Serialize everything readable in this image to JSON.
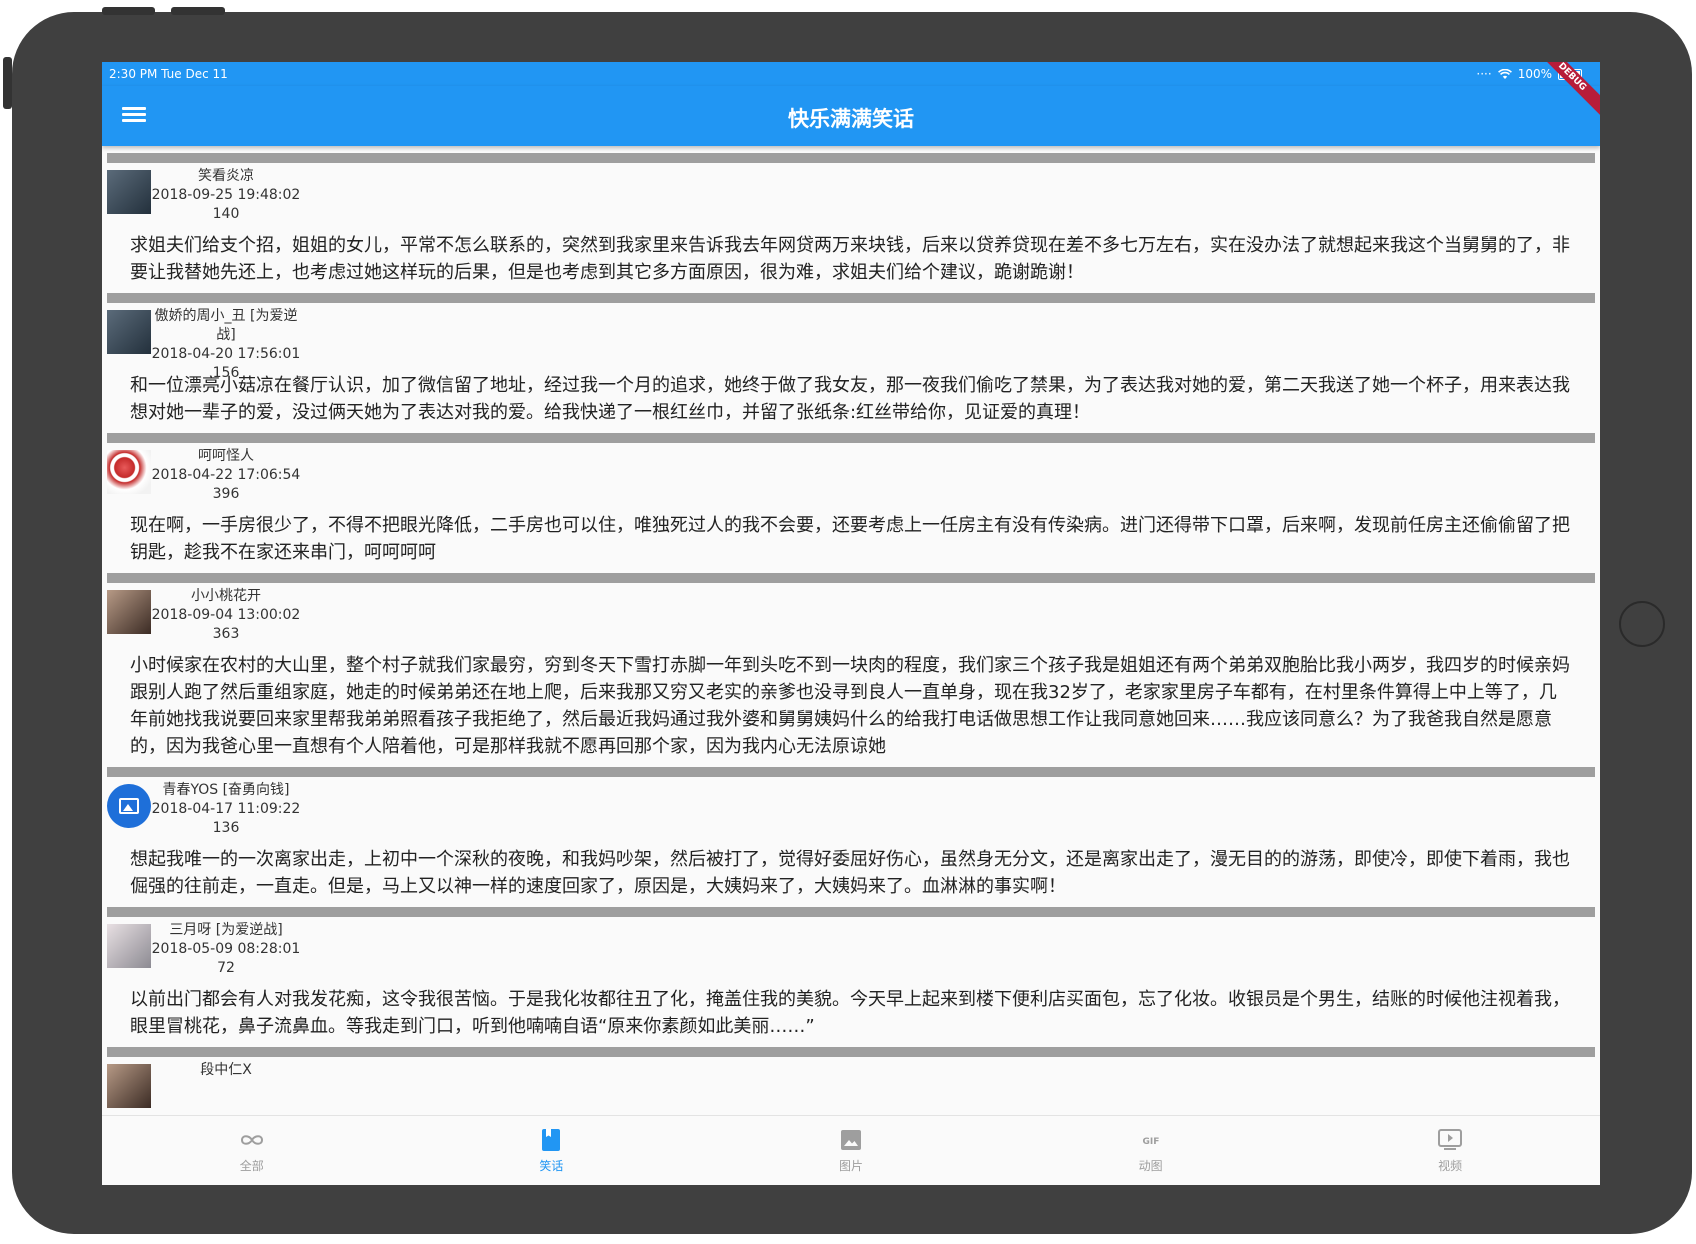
{
  "status_bar": {
    "time": "2:30 PM   Tue Dec 11",
    "battery": "100%",
    "debug": "DEBUG"
  },
  "app_bar": {
    "title": "快乐满满笑话"
  },
  "posts": [
    {
      "author": "笑看炎凉",
      "date": "2018-09-25 19:48:02",
      "count": "140",
      "text": "求姐夫们给支个招，姐姐的女儿，平常不怎么联系的，突然到我家里来告诉我去年网贷两万来块钱，后来以贷养贷现在差不多七万左右，实在没办法了就想起来我这个当舅舅的了，非要让我替她先还上，也考虑过她这样玩的后果，但是也考虑到其它多方面原因，很为难，求姐夫们给个建议，跪谢跪谢！"
    },
    {
      "author": "傲娇的周小_丑 [为爱逆战]",
      "date": "2018-04-20 17:56:01",
      "count": "156",
      "text": "和一位漂亮小菇凉在餐厅认识，加了微信留了地址，经过我一个月的追求，她终于做了我女友，那一夜我们偷吃了禁果，为了表达我对她的爱，第二天我送了她一个杯子，用来表达我想对她一辈子的爱，没过俩天她为了表达对我的爱。给我快递了一根红丝巾，并留了张纸条:红丝带给你，见证爱的真理！"
    },
    {
      "author": "呵呵怪人",
      "date": "2018-04-22 17:06:54",
      "count": "396",
      "text": "现在啊，一手房很少了，不得不把眼光降低，二手房也可以住，唯独死过人的我不会要，还要考虑上一任房主有没有传染病。进门还得带下口罩，后来啊，发现前任房主还偷偷留了把钥匙，趁我不在家还来串门，呵呵呵呵"
    },
    {
      "author": "小小桃花开",
      "date": "2018-09-04 13:00:02",
      "count": "363",
      "text": "小时候家在农村的大山里，整个村子就我们家最穷，穷到冬天下雪打赤脚一年到头吃不到一块肉的程度，我们家三个孩子我是姐姐还有两个弟弟双胞胎比我小两岁，我四岁的时候亲妈跟别人跑了然后重组家庭，她走的时候弟弟还在地上爬，后来我那又穷又老实的亲爹也没寻到良人一直单身，现在我32岁了，老家家里房子车都有，在村里条件算得上中上等了，几年前她找我说要回来家里帮我弟弟照看孩子我拒绝了，然后最近我妈通过我外婆和舅舅姨妈什么的给我打电话做思想工作让我同意她回来……我应该同意么？为了我爸我自然是愿意的，因为我爸心里一直想有个人陪着他，可是那样我就不愿再回那个家，因为我内心无法原谅她"
    },
    {
      "author": "青春YOS [奋勇向钱]",
      "date": "2018-04-17 11:09:22",
      "count": "136",
      "text": "想起我唯一的一次离家出走，上初中一个深秋的夜晚，和我妈吵架，然后被打了，觉得好委屈好伤心，虽然身无分文，还是离家出走了，漫无目的的游荡，即使冷，即使下着雨，我也倔强的往前走，一直走。但是，马上又以神一样的速度回家了，原因是，大姨妈来了，大姨妈来了。血淋淋的事实啊！"
    },
    {
      "author": "三月呀 [为爱逆战]",
      "date": "2018-05-09 08:28:01",
      "count": "72",
      "text": "以前出门都会有人对我发花痴，这令我很苦恼。于是我化妆都往丑了化，掩盖住我的美貌。今天早上起来到楼下便利店买面包，忘了化妆。收银员是个男生，结账的时候他注视着我，眼里冒桃花，鼻子流鼻血。等我走到门口，听到他喃喃自语“原来你素颜如此美丽……”"
    },
    {
      "author": "段中仁X",
      "date": "",
      "count": "",
      "text": ""
    }
  ],
  "bottom_nav": [
    {
      "label": "全部",
      "icon": "infinity-icon"
    },
    {
      "label": "笑话",
      "icon": "bookmark-icon"
    },
    {
      "label": "图片",
      "icon": "image-icon"
    },
    {
      "label": "动图",
      "icon": "gif-icon"
    },
    {
      "label": "视频",
      "icon": "video-icon"
    }
  ],
  "colors": {
    "primary": "#2196f3",
    "divider": "#9e9e9e",
    "inactive": "#9e9e9e"
  }
}
